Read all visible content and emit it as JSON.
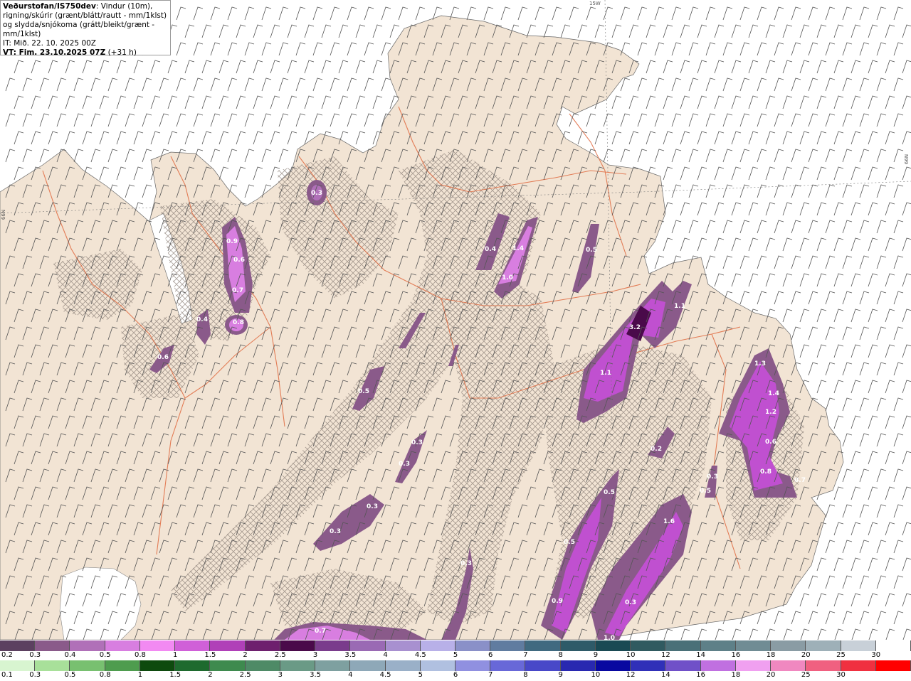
{
  "info": {
    "title": "Veðurstofan/IS750dev",
    "desc": ": Vindur (10m), rigning/skúrir (grænt/blátt/rautt - mm/1klst) og slydda/snjókoma (grátt/bleikt/grænt - mm/1klst)",
    "it": "IT: Mið. 22. 10. 2025 00Z",
    "vt_label": "VT: Fim. 23.10.2025 07Z",
    "vt_offset": " (+31 h)"
  },
  "axis": {
    "lon": "15W",
    "lat_right": "66N",
    "lat_left": "66N"
  },
  "colors": {
    "land": "#f2e4d4",
    "sea": "#ffffff",
    "hatch": "#8a7e76",
    "roads": "#e06a40",
    "precip": "#c050d0"
  },
  "precip_labels": [
    "0.3",
    "0.9",
    "0.6",
    "0.7",
    "0.4",
    "0.8",
    "0.6",
    "0.4",
    "1.4",
    "1.0",
    "0.5",
    "3.2",
    "1.1",
    "1.1",
    "1.3",
    "1.4",
    "1.2",
    "0.6",
    "0.8",
    "0.7",
    "0.2",
    "0.3",
    "0.5",
    "0.3",
    "0.3",
    "0.3",
    "0.3",
    "0.3",
    "0.5",
    "0.5",
    "1.6",
    "0.9",
    "0.5",
    "0.3",
    "0.7",
    "1.0"
  ],
  "legend_snow": {
    "labels": [
      "0.2",
      "0.3",
      "0.4",
      "0.5",
      "0.8",
      "1",
      "1.5",
      "2",
      "2.5",
      "3",
      "3.5",
      "4",
      "4.5",
      "5",
      "6",
      "7",
      "8",
      "9",
      "10",
      "12",
      "14",
      "16",
      "18",
      "20",
      "25",
      "30"
    ],
    "colors": [
      "#5c4060",
      "#8a5a8a",
      "#b070b8",
      "#d87ee0",
      "#f28af2",
      "#d060d8",
      "#b040b8",
      "#6e206e",
      "#4a0a4a",
      "#7a3c8c",
      "#9a6ab4",
      "#a890d0",
      "#b8b0e8",
      "#8a90c8",
      "#607ca0",
      "#406a80",
      "#2e5a68",
      "#1a4a54",
      "#305a60",
      "#4a7078",
      "#5e8088",
      "#708c94",
      "#8a9ca4",
      "#9eb0b8",
      "#c8d0d8",
      "#ffffff"
    ]
  },
  "legend_rain": {
    "labels": [
      "0.1",
      "0.3",
      "0.5",
      "0.8",
      "1",
      "1.5",
      "2",
      "2.5",
      "3",
      "3.5",
      "4",
      "4.5",
      "5",
      "6",
      "7",
      "8",
      "9",
      "10",
      "12",
      "14",
      "16",
      "18",
      "20",
      "25",
      "30"
    ],
    "colors": [
      "#d8f5d0",
      "#a8e09a",
      "#78c070",
      "#4e9c4e",
      "#0e4a0e",
      "#1e6a2e",
      "#3e8a4e",
      "#4e8a66",
      "#6a9a86",
      "#7ea0a0",
      "#8ea8b8",
      "#9ab0c8",
      "#b0c0e0",
      "#9090e0",
      "#6868d8",
      "#4848c8",
      "#2828b0",
      "#0808a0",
      "#3030b8",
      "#7050c8",
      "#c070e0",
      "#f0a0f0",
      "#f088c0",
      "#f06080",
      "#f03040",
      "#ff0000"
    ]
  }
}
